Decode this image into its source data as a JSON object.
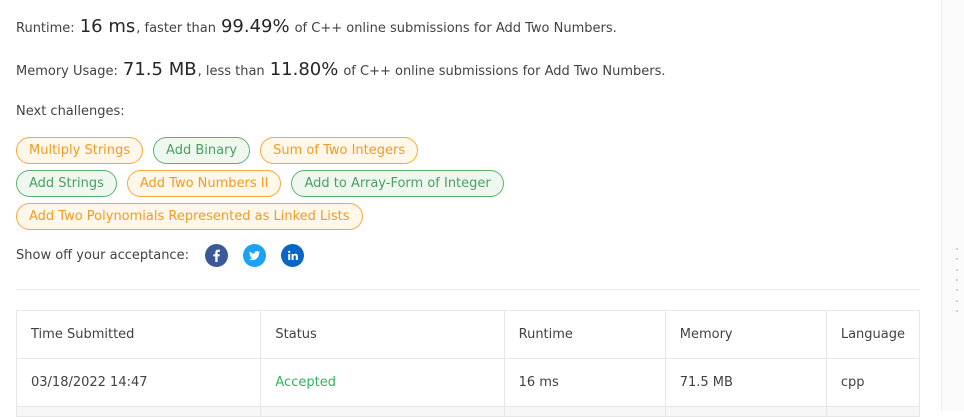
{
  "result": {
    "runtime": {
      "label": "Runtime:",
      "value": "16 ms",
      "mid": ", faster than",
      "percent": "99.49%",
      "suffix": "of C++ online submissions for Add Two Numbers."
    },
    "memory": {
      "label": "Memory Usage:",
      "value": "71.5 MB",
      "mid": ", less than",
      "percent": "11.80%",
      "suffix": "of C++ online submissions for Add Two Numbers."
    }
  },
  "next_challenges": {
    "label": "Next challenges:",
    "items": [
      {
        "label": "Multiply Strings",
        "difficulty": "medium"
      },
      {
        "label": "Add Binary",
        "difficulty": "easy"
      },
      {
        "label": "Sum of Two Integers",
        "difficulty": "medium"
      },
      {
        "label": "Add Strings",
        "difficulty": "easy"
      },
      {
        "label": "Add Two Numbers II",
        "difficulty": "medium"
      },
      {
        "label": "Add to Array-Form of Integer",
        "difficulty": "easy"
      },
      {
        "label": "Add Two Polynomials Represented as Linked Lists",
        "difficulty": "medium"
      }
    ]
  },
  "share": {
    "label": "Show off your acceptance:",
    "icons": [
      "facebook-icon",
      "twitter-icon",
      "linkedin-icon"
    ]
  },
  "colors": {
    "medium": "#ef9d25",
    "easy": "#4a9f62",
    "accepted": "#2db55d",
    "facebook": "#3b5998",
    "twitter": "#1da1f2",
    "linkedin": "#0a66c2"
  },
  "submissions": {
    "headers": [
      "Time Submitted",
      "Status",
      "Runtime",
      "Memory",
      "Language"
    ],
    "rows": [
      {
        "time": "03/18/2022 14:47",
        "status": "Accepted",
        "runtime": "16 ms",
        "memory": "71.5 MB",
        "language": "cpp"
      }
    ]
  }
}
